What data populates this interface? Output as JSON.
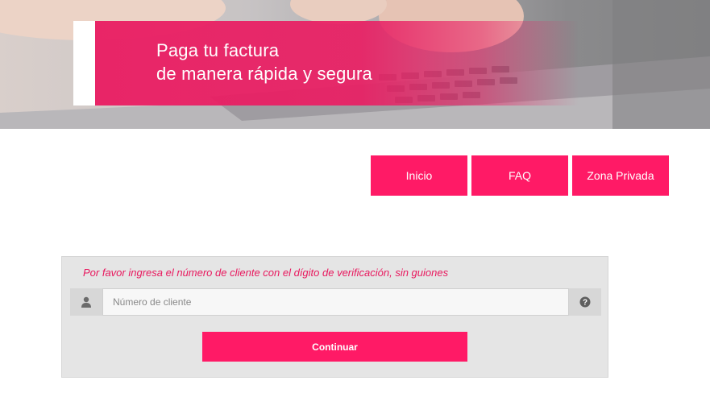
{
  "hero": {
    "title_line1": "Paga tu factura",
    "title_line2": "de manera rápida y segura"
  },
  "nav": {
    "inicio": "Inicio",
    "faq": "FAQ",
    "zona_privada": "Zona Privada"
  },
  "form": {
    "hint": "Por favor ingresa el número de cliente con el dígito de verificación, sin guiones",
    "client_number_placeholder": "Número de cliente",
    "client_number_value": "",
    "continue_label": "Continuar",
    "left_icon": "user-icon",
    "right_icon": "help-icon"
  },
  "colors": {
    "accent": "#ff1a66",
    "hint_text": "#e8175d",
    "panel_bg": "#e5e5e5"
  }
}
